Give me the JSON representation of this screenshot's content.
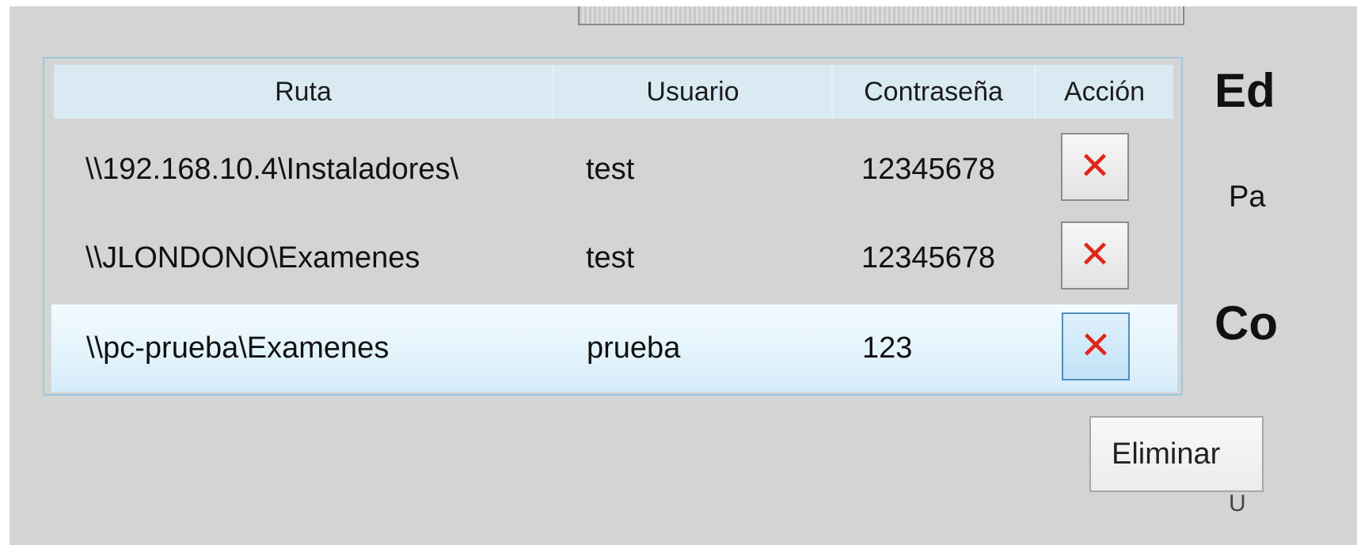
{
  "table": {
    "headers": [
      "Ruta",
      "Usuario",
      "Contraseña",
      "Acción"
    ],
    "rows": [
      {
        "ruta": "\\\\192.168.10.4\\Instaladores\\",
        "usuario": "test",
        "contrasena": "12345678",
        "accion_icon": "delete-x-icon"
      },
      {
        "ruta": "\\\\JLONDONO\\Examenes",
        "usuario": "test",
        "contrasena": "12345678",
        "accion_icon": "delete-x-icon"
      },
      {
        "ruta": "\\\\pc-prueba\\Examenes",
        "usuario": "prueba",
        "contrasena": "123",
        "accion_icon": "delete-x-icon"
      }
    ],
    "selected_row": 2
  },
  "side": {
    "heading_top": "Ed",
    "label": "Pa",
    "heading_bottom": "Co",
    "delete_button_label": "Eliminar",
    "bottom_fragment": "U"
  },
  "colors": {
    "delete_icon": "#e0261b",
    "header_bg": "#d9eaf3",
    "selection": "#d6edf9"
  }
}
